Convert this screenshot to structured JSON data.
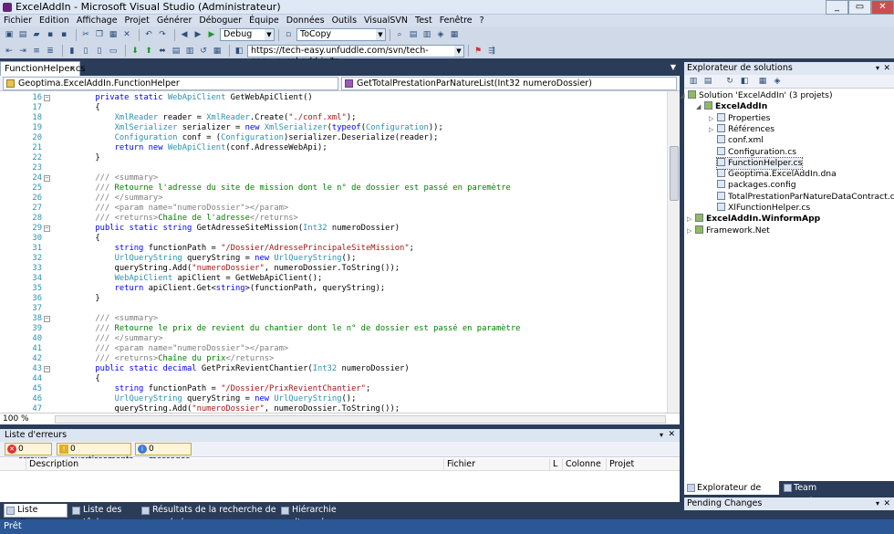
{
  "window": {
    "title": "ExcelAddIn - Microsoft Visual Studio (Administrateur)"
  },
  "menu": [
    "Fichier",
    "Edition",
    "Affichage",
    "Projet",
    "Générer",
    "Déboguer",
    "Équipe",
    "Données",
    "Outils",
    "VisualSVN",
    "Test",
    "Fenêtre",
    "?"
  ],
  "toolbar": {
    "config": "Debug",
    "find": "ToCopy",
    "url": "https://tech-easy.unfuddle.com/svn/tech-easy_excel-add-in/tr"
  },
  "editor": {
    "tab": "FunctionHelper.cs",
    "class_nav": "Geoptima.ExcelAddIn.FunctionHelper",
    "member_nav": "GetTotalPrestationParNatureList(Int32 numeroDossier)",
    "zoom": "100 %",
    "lines": [
      {
        "n": "16",
        "t": "        private static WebApiClient GetWebApiClient()"
      },
      {
        "n": "17",
        "t": "        {"
      },
      {
        "n": "18",
        "t": "            XmlReader reader = XmlReader.Create(\"./conf.xml\");"
      },
      {
        "n": "19",
        "t": "            XmlSerializer serializer = new XmlSerializer(typeof(Configuration));"
      },
      {
        "n": "20",
        "t": "            Configuration conf = (Configuration)serializer.Deserialize(reader);"
      },
      {
        "n": "21",
        "t": "            return new WebApiClient(conf.AdresseWebApi);"
      },
      {
        "n": "22",
        "t": "        }"
      },
      {
        "n": "23",
        "t": ""
      },
      {
        "n": "24",
        "t": "        /// <summary>"
      },
      {
        "n": "25",
        "t": "        /// Retourne l'adresse du site de mission dont le n° de dossier est passé en paremètre"
      },
      {
        "n": "26",
        "t": "        /// </summary>"
      },
      {
        "n": "27",
        "t": "        /// <param name=\"numeroDossier\"></param>"
      },
      {
        "n": "28",
        "t": "        /// <returns>Chaîne de l'adresse</returns>"
      },
      {
        "n": "29",
        "t": "        public static string GetAdresseSiteMission(Int32 numeroDossier)"
      },
      {
        "n": "30",
        "t": "        {"
      },
      {
        "n": "31",
        "t": "            string functionPath = \"/Dossier/AdressePrincipaleSiteMission\";"
      },
      {
        "n": "32",
        "t": "            UrlQueryString queryString = new UrlQueryString();"
      },
      {
        "n": "33",
        "t": "            queryString.Add(\"numeroDossier\", numeroDossier.ToString());"
      },
      {
        "n": "34",
        "t": "            WebApiClient apiClient = GetWebApiClient();"
      },
      {
        "n": "35",
        "t": "            return apiClient.Get<string>(functionPath, queryString);"
      },
      {
        "n": "36",
        "t": "        }"
      },
      {
        "n": "37",
        "t": ""
      },
      {
        "n": "38",
        "t": "        /// <summary>"
      },
      {
        "n": "39",
        "t": "        /// Retourne le prix de revient du chantier dont le n° de dossier est passé en paramètre"
      },
      {
        "n": "40",
        "t": "        /// </summary>"
      },
      {
        "n": "41",
        "t": "        /// <param name=\"numeroDossier\"></param>"
      },
      {
        "n": "42",
        "t": "        /// <returns>Chaîne du prix</returns>"
      },
      {
        "n": "43",
        "t": "        public static decimal GetPrixRevientChantier(Int32 numeroDossier)"
      },
      {
        "n": "44",
        "t": "        {"
      },
      {
        "n": "45",
        "t": "            string functionPath = \"/Dossier/PrixRevientChantier\";"
      },
      {
        "n": "46",
        "t": "            UrlQueryString queryString = new UrlQueryString();"
      },
      {
        "n": "47",
        "t": "            queryString.Add(\"numeroDossier\", numeroDossier.ToString());"
      }
    ]
  },
  "errors": {
    "title": "Liste d'erreurs",
    "filters": [
      "0 erreurs",
      "0 avertissements",
      "0 messages"
    ],
    "columns": [
      "Description",
      "Fichier",
      "L",
      "Colonne",
      "Projet"
    ]
  },
  "bottom_tabs": [
    "Liste d'erreurs",
    "Liste des tâches",
    "Résultats de la recherche de symbole",
    "Hiérarchie d'appels"
  ],
  "solution": {
    "title": "Explorateur de solutions",
    "items": [
      {
        "label": "Solution 'ExcelAddIn' (3 projets)",
        "level": 0
      },
      {
        "label": "ExcelAddIn",
        "level": 1,
        "bold": true
      },
      {
        "label": "Properties",
        "level": 2
      },
      {
        "label": "Références",
        "level": 2
      },
      {
        "label": "conf.xml",
        "level": 2
      },
      {
        "label": "Configuration.cs",
        "level": 2
      },
      {
        "label": "FunctionHelper.cs",
        "level": 2
      },
      {
        "label": "Geoptima.ExcelAddIn.dna",
        "level": 2
      },
      {
        "label": "packages.config",
        "level": 2
      },
      {
        "label": "TotalPrestationParNatureDataContract.cs",
        "level": 2
      },
      {
        "label": "XlFunctionHelper.cs",
        "level": 2
      },
      {
        "label": "ExcelAddIn.WinformApp",
        "level": 0,
        "bold": true
      },
      {
        "label": "Framework.Net",
        "level": 0
      }
    ],
    "tabs": [
      "Explorateur de solutions",
      "Team Explorer"
    ]
  },
  "pending": {
    "title": "Pending Changes"
  },
  "status": "Prêt"
}
